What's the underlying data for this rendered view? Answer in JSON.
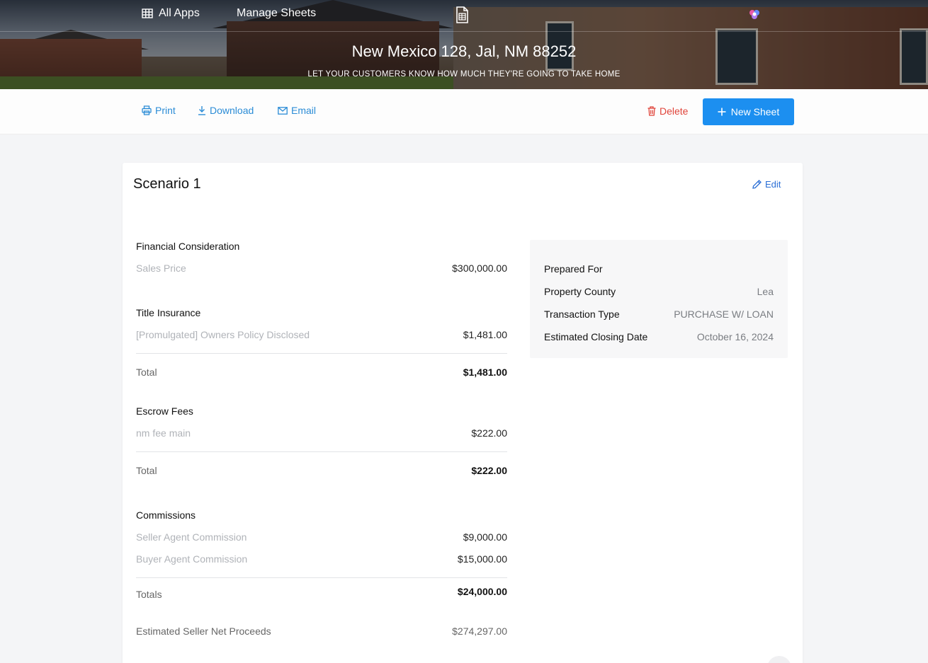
{
  "topnav": {
    "all_apps": "All Apps",
    "manage_sheets": "Manage Sheets"
  },
  "hero": {
    "title": "New Mexico 128, Jal, NM 88252",
    "subtitle": "LET YOUR CUSTOMERS KNOW HOW MUCH THEY'RE GOING TO TAKE HOME"
  },
  "toolbar": {
    "print": "Print",
    "download": "Download",
    "email": "Email",
    "delete": "Delete",
    "new_sheet": "New Sheet"
  },
  "card": {
    "title": "Scenario 1",
    "edit": "Edit",
    "financial": {
      "heading": "Financial Consideration",
      "sales_price_label": "Sales Price",
      "sales_price_value": "$300,000.00"
    },
    "title_insurance": {
      "heading": "Title Insurance",
      "item_label": "[Promulgated] Owners Policy Disclosed",
      "item_value": "$1,481.00",
      "total_label": "Total",
      "total_value": "$1,481.00"
    },
    "escrow": {
      "heading": "Escrow Fees",
      "item_label": "nm fee main",
      "item_value": "$222.00",
      "total_label": "Total",
      "total_value": "$222.00"
    },
    "commissions": {
      "heading": "Commissions",
      "seller_label": "Seller Agent Commission",
      "seller_value": "$9,000.00",
      "buyer_label": "Buyer Agent Commission",
      "buyer_value": "$15,000.00",
      "total_label": "Totals",
      "total_value": "$24,000.00"
    },
    "net": {
      "label": "Estimated Seller Net Proceeds",
      "value": "$274,297.00"
    },
    "info": {
      "prepared_for": "Prepared For",
      "county_label": "Property County",
      "county_value": "Lea",
      "transaction_label": "Transaction Type",
      "transaction_value": "PURCHASE W/ LOAN",
      "closing_label": "Estimated Closing Date",
      "closing_value": "October 16, 2024"
    }
  },
  "colors": {
    "accent": "#1c8ff0",
    "link": "#2b8cd6",
    "danger": "#e0443a"
  }
}
